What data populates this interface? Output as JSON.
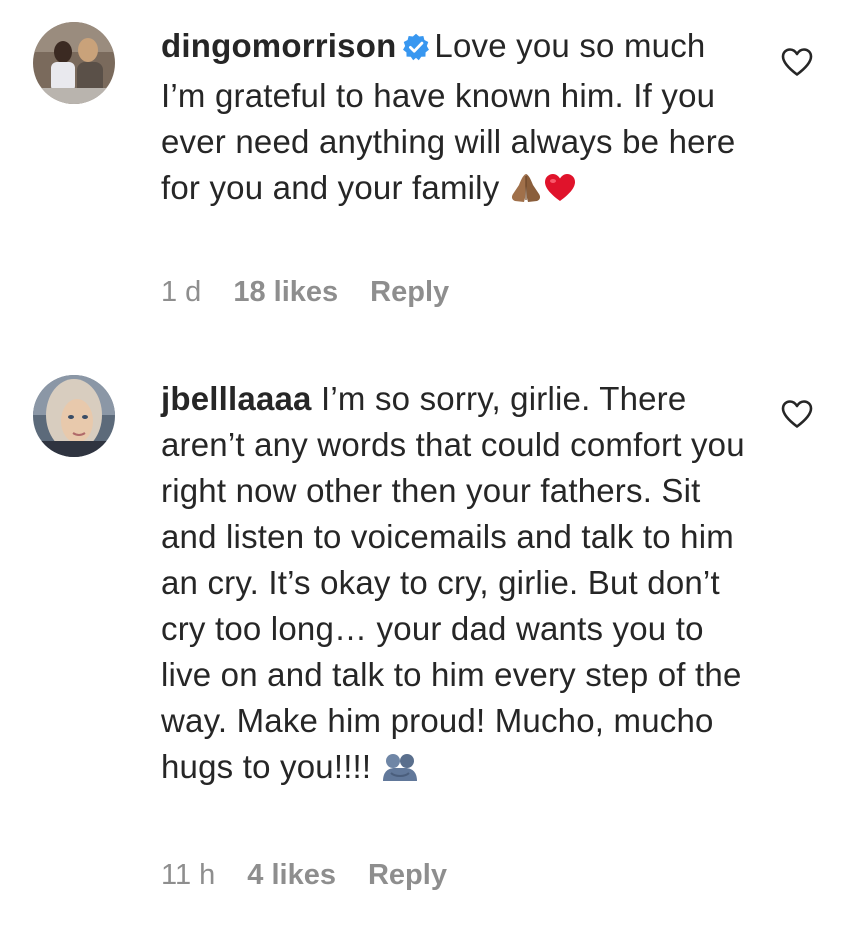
{
  "comments": [
    {
      "username": "dingomorrison",
      "verified": true,
      "text": "Love you so much I’m grateful to have known him. If you ever need anything will always be here for you and your family",
      "emoji": [
        "folded-hands-icon",
        "red-heart-icon"
      ],
      "time": "1 d",
      "likes": "18 likes",
      "reply": "Reply"
    },
    {
      "username": "jbelllaaaa",
      "verified": false,
      "text": "I’m so sorry, girlie. There aren’t any words that could comfort you right now other then your fathers. Sit and listen to voicemails and talk to him an cry. It’s okay to cry, girlie. But don’t cry too long… your dad wants you to live on and talk to him every step of the way. Make him proud! Mucho, mucho hugs to you!!!!",
      "emoji": [
        "people-hugging-icon"
      ],
      "time": "11 h",
      "likes": "4 likes",
      "reply": "Reply"
    }
  ],
  "colors": {
    "text": "#262626",
    "meta": "#8e8e8e",
    "verified": "#3897f0",
    "heart_outline": "#262626"
  }
}
